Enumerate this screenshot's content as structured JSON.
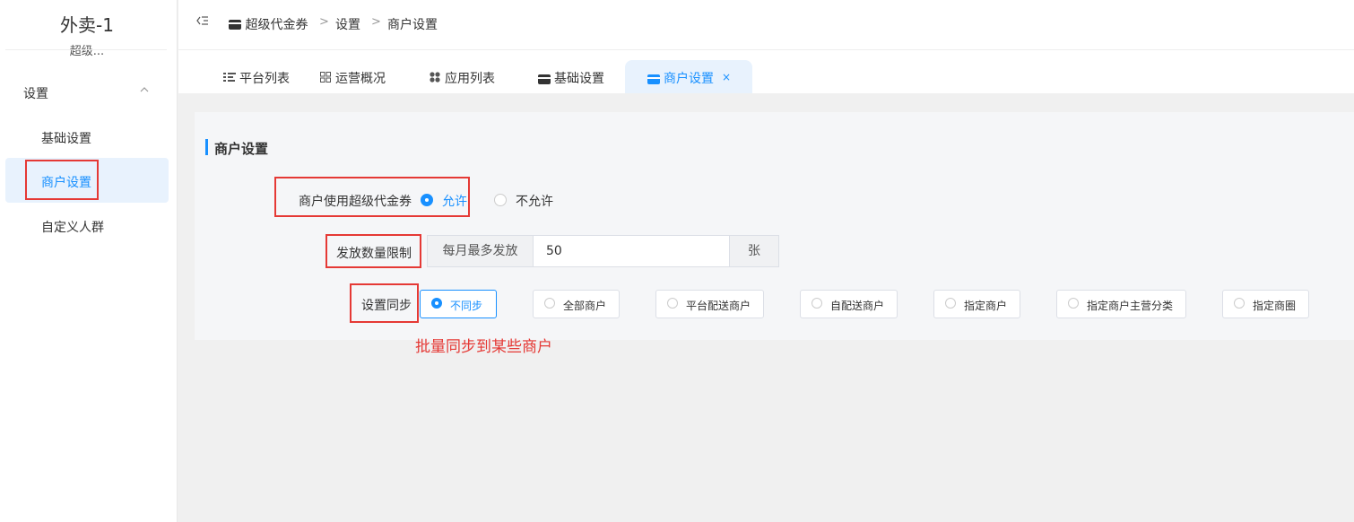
{
  "sidebar": {
    "app_title": "外卖-1",
    "app_subtitle": "超级...",
    "group_label": "设置",
    "group_chevron": "^",
    "items": [
      {
        "label": "基础设置"
      },
      {
        "label": "商户设置"
      },
      {
        "label": "自定义人群"
      }
    ]
  },
  "header": {
    "collapse_icon": "☰",
    "breadcrumb": [
      "超级代金券",
      "设置",
      "商户设置"
    ],
    "separator": ">"
  },
  "tabs": [
    {
      "label": "平台列表",
      "icon": "list-icon"
    },
    {
      "label": "运营概况",
      "icon": "grid-icon"
    },
    {
      "label": "应用列表",
      "icon": "apps-icon"
    },
    {
      "label": "基础设置",
      "icon": "card-icon"
    },
    {
      "label": "商户设置",
      "icon": "card-icon",
      "active": true,
      "close": "×"
    }
  ],
  "section": {
    "title": "商户设置"
  },
  "form": {
    "voucher_label": "商户使用超级代金券",
    "voucher_options": [
      "允许",
      "不允许"
    ],
    "voucher_selected": "允许",
    "limit_label": "发放数量限制",
    "limit_prepend": "每月最多发放",
    "limit_value": "50",
    "limit_append": "张",
    "sync_label": "设置同步",
    "sync_options": [
      "不同步",
      "全部商户",
      "平台配送商户",
      "自配送商户",
      "指定商户",
      "指定商户主营分类",
      "指定商圈"
    ],
    "sync_selected": "不同步"
  },
  "annotation": "批量同步到某些商户",
  "colors": {
    "accent": "#1890ff",
    "highlight": "#e53935",
    "active_bg": "#e8f2fd"
  }
}
